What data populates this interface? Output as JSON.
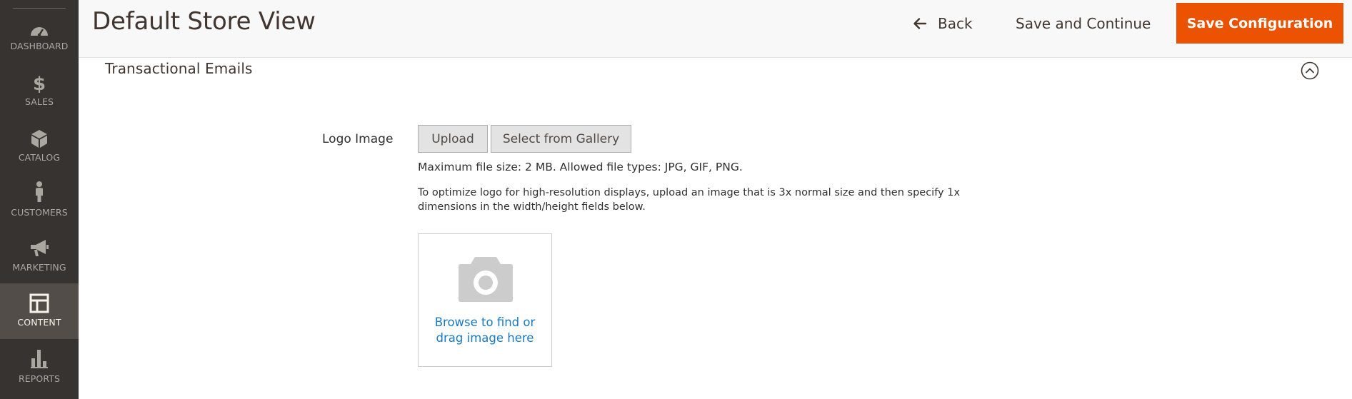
{
  "sidebar": {
    "items": [
      {
        "label": "DASHBOARD",
        "icon": "dashboard-icon",
        "active": false
      },
      {
        "label": "SALES",
        "icon": "dollar-icon",
        "active": false
      },
      {
        "label": "CATALOG",
        "icon": "cube-icon",
        "active": false
      },
      {
        "label": "CUSTOMERS",
        "icon": "person-icon",
        "active": false
      },
      {
        "label": "MARKETING",
        "icon": "megaphone-icon",
        "active": false
      },
      {
        "label": "CONTENT",
        "icon": "layout-icon",
        "active": true
      },
      {
        "label": "REPORTS",
        "icon": "bar-chart-icon",
        "active": false
      }
    ]
  },
  "header": {
    "title": "Default Store View",
    "back_label": "Back",
    "save_continue_label": "Save and Continue",
    "save_config_label": "Save Configuration"
  },
  "section": {
    "title": "Transactional Emails",
    "collapse_icon": "chevron-up-circle-icon"
  },
  "logo_field": {
    "label": "Logo Image",
    "upload_label": "Upload",
    "gallery_label": "Select from Gallery",
    "size_note": "Maximum file size: 2 MB. Allowed file types: JPG, GIF, PNG.",
    "optimize_note": "To optimize logo for high-resolution displays, upload an image that is 3x normal size and then specify 1x dimensions in the width/height fields below.",
    "dropzone_text_line1": "Browse to find or",
    "dropzone_text_line2": "drag image here"
  },
  "colors": {
    "sidebar_bg": "#373330",
    "sidebar_active_bg": "#524d49",
    "primary_button": "#eb5202",
    "link": "#1979c3"
  }
}
